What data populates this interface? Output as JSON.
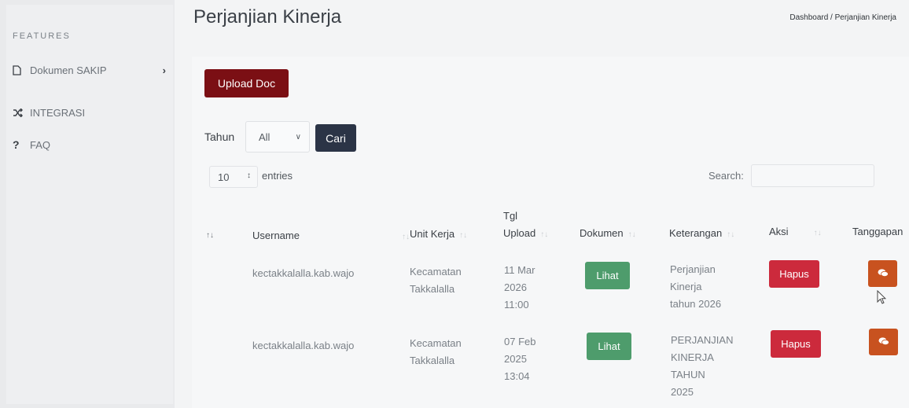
{
  "sidebar": {
    "features_label": "FEATURES",
    "items": [
      {
        "label": "Dokumen SAKIP",
        "icon": "file-icon"
      },
      {
        "label": "INTEGRASI",
        "icon": "shuffle-icon"
      },
      {
        "label": "FAQ",
        "icon": "question-icon"
      }
    ]
  },
  "header": {
    "title": "Perjanjian Kinerja",
    "breadcrumb": "Dashboard  /  Perjanjian Kinerja"
  },
  "toolbar": {
    "upload_label": "Upload Doc",
    "tahun_label": "Tahun",
    "tahun_value": "All",
    "cari_label": "Cari"
  },
  "table_controls": {
    "entries_value": "10",
    "entries_label": "entries",
    "search_label": "Search:"
  },
  "table": {
    "columns": {
      "no": "",
      "username": "Username",
      "unit_kerja": "Unit Kerja",
      "tgl_upload_1": "Tgl",
      "tgl_upload_2": "Upload",
      "dokumen": "Dokumen",
      "keterangan": "Keterangan",
      "aksi": "Aksi",
      "tanggapan": "Tanggapan"
    },
    "rows": [
      {
        "username": "kectakkalalla.kab.wajo",
        "unit_1": "Kecamatan",
        "unit_2": "Takkalalla",
        "tgl_1": "11 Mar",
        "tgl_2": "2026",
        "tgl_3": "11:00",
        "dokumen": "Lihat",
        "ket_1": "Perjanjian",
        "ket_2": "Kinerja",
        "ket_3": "tahun 2026",
        "ket_4": "",
        "aksi": "Hapus"
      },
      {
        "username": "kectakkalalla.kab.wajo",
        "unit_1": "Kecamatan",
        "unit_2": "Takkalalla",
        "tgl_1": "07 Feb",
        "tgl_2": "2025",
        "tgl_3": "13:04",
        "dokumen": "Lihat",
        "ket_1": "PERJANJIAN",
        "ket_2": "KINERJA",
        "ket_3": "TAHUN",
        "ket_4": "2025",
        "aksi": "Hapus"
      }
    ]
  },
  "colors": {
    "upload": "#7b0f14",
    "cari": "#2b3446",
    "lihat": "#4e9c6c",
    "hapus": "#cc2a3c",
    "tanggapan": "#c8521f"
  }
}
